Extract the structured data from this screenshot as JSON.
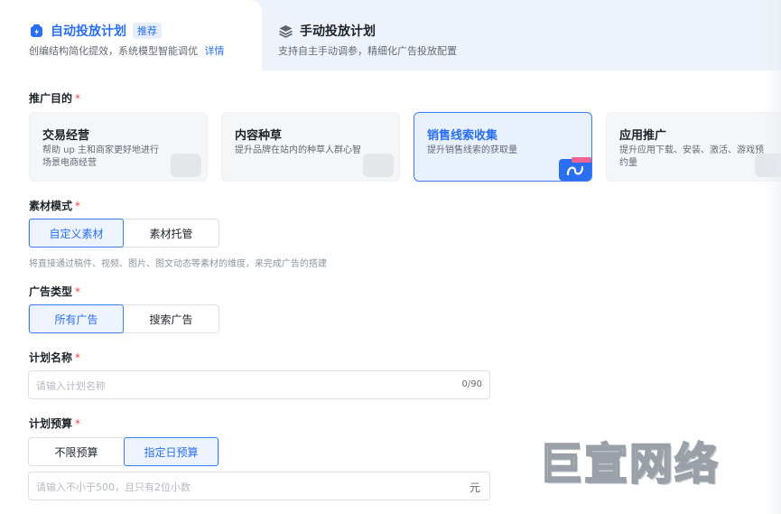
{
  "tabs": {
    "auto": {
      "title": "自动投放计划",
      "badge": "推荐",
      "subtitle": "创编结构简化提效，系统模型智能调优",
      "link": "详情"
    },
    "manual": {
      "title": "手动投放计划",
      "subtitle": "支持自主手动调参，精细化广告投放配置"
    }
  },
  "goal": {
    "label": "推广目的",
    "cards": [
      {
        "title": "交易经营",
        "desc": "帮助 up 主和商家更好地进行　　　场景电商经营"
      },
      {
        "title": "内容种草",
        "desc": "提升品牌在站内的种草人群心智"
      },
      {
        "title": "销售线索收集",
        "desc": "提升销售线索的获取量"
      },
      {
        "title": "应用推广",
        "desc": "提升应用下载、安装、激活、游戏预约量"
      }
    ],
    "selected_index": 2
  },
  "material": {
    "label": "素材模式",
    "options": [
      "自定义素材",
      "素材托管"
    ],
    "active": "自定义素材",
    "hint": "将直接通过稿件、视频、图片、图文动态等素材的维度，来完成广告的搭建"
  },
  "adtype": {
    "label": "广告类型",
    "options": [
      "所有广告",
      "搜索广告"
    ],
    "active": "所有广告"
  },
  "plan_name": {
    "label": "计划名称",
    "placeholder": "请输入计划名称",
    "counter": "0/90"
  },
  "budget": {
    "label": "计划预算",
    "options": [
      "不限预算",
      "指定日预算"
    ],
    "active": "指定日预算",
    "placeholder": "请输入不小于500，且只有2位小数",
    "unit": "元"
  },
  "watermark": "巨宣网络",
  "colors": {
    "accent": "#2a6ff0",
    "required": "#e24b4b"
  }
}
